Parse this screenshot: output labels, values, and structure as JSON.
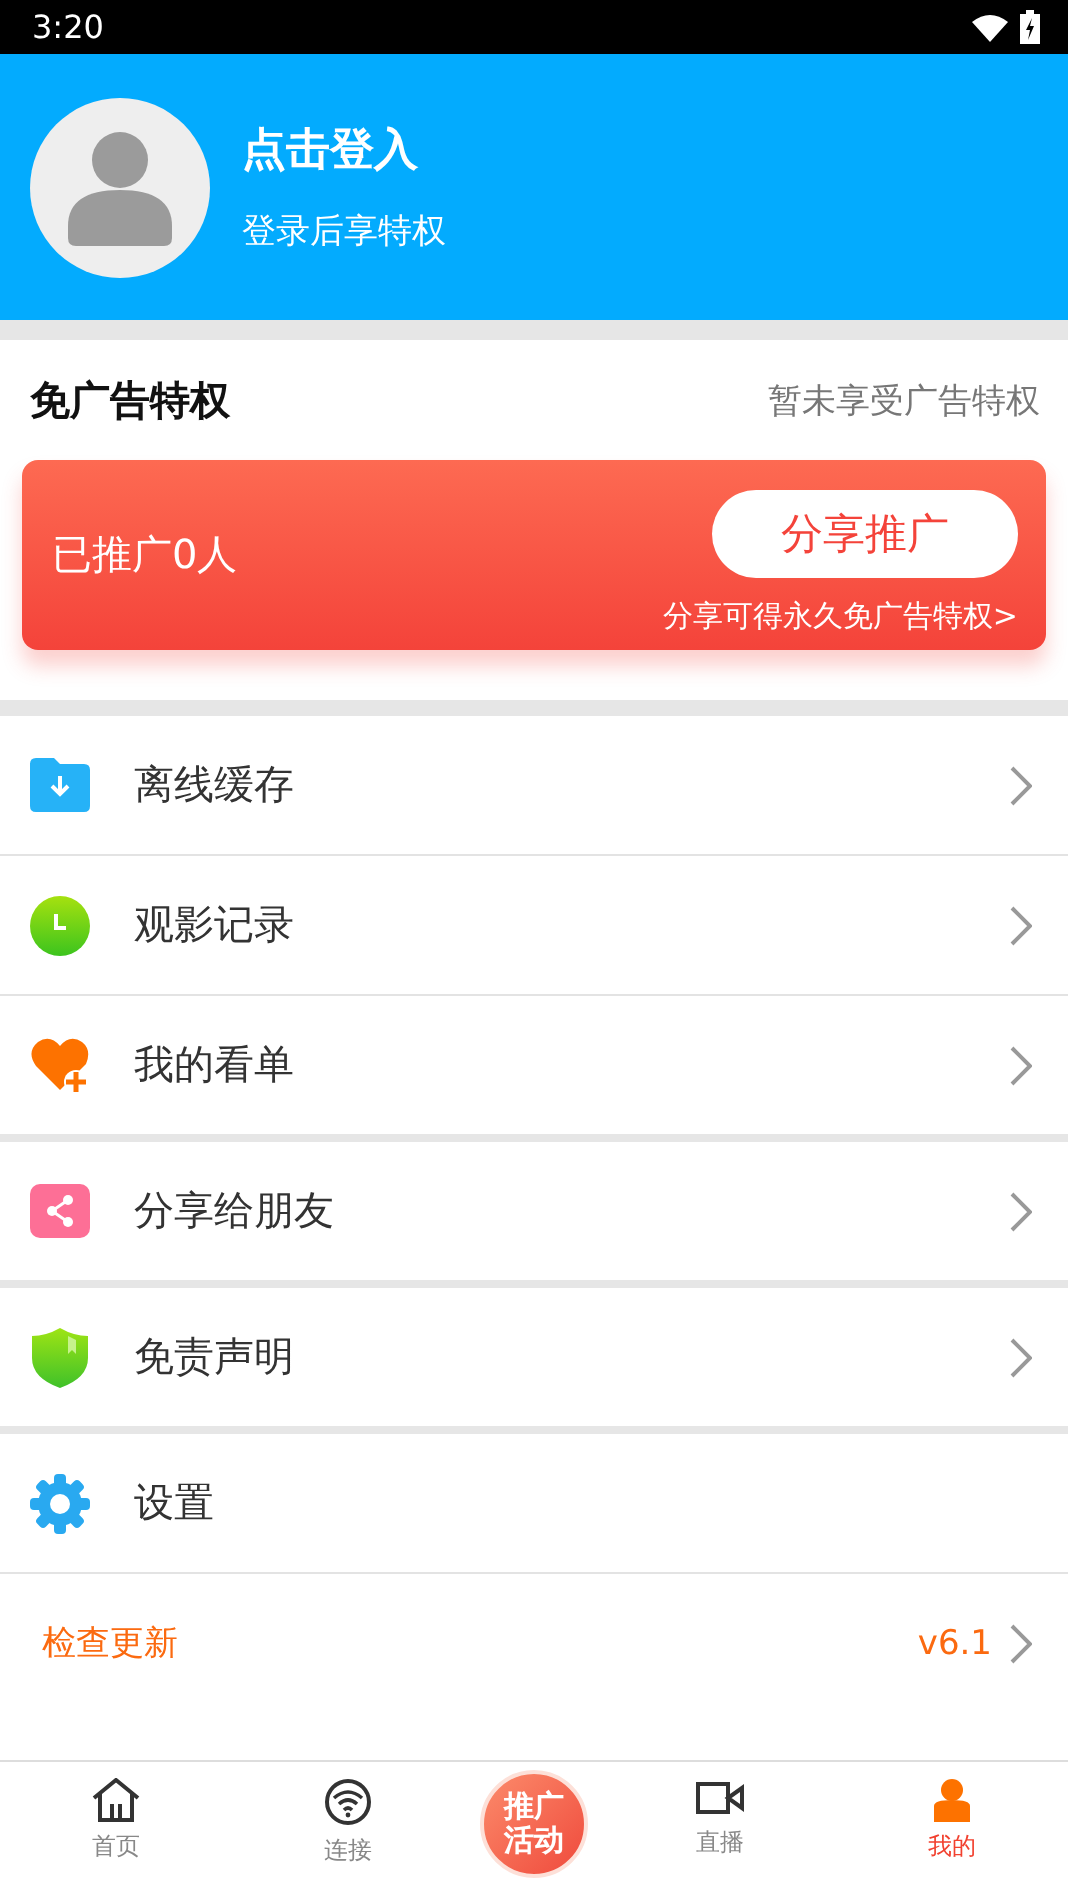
{
  "status_bar": {
    "time": "3:20"
  },
  "profile": {
    "title": "点击登入",
    "subtitle": "登录后享特权"
  },
  "ad_free": {
    "title": "免广告特权",
    "status": "暂未享受广告特权",
    "promoted": "已推广0人",
    "button": "分享推广",
    "hint": "分享可得永久免广告特权>"
  },
  "menu_groups": [
    [
      {
        "kind": "download",
        "label": "离线缓存"
      },
      {
        "kind": "history",
        "label": "观影记录"
      },
      {
        "kind": "watchlist",
        "label": "我的看单"
      }
    ],
    [
      {
        "kind": "share",
        "label": "分享给朋友"
      }
    ],
    [
      {
        "kind": "disclaimer",
        "label": "免责声明"
      }
    ],
    [
      {
        "kind": "settings",
        "label": "设置"
      },
      {
        "kind": "update",
        "label": "检查更新",
        "version": "v6.1"
      }
    ]
  ],
  "bottom_nav": [
    {
      "kind": "home",
      "label": "首页",
      "selected": false
    },
    {
      "kind": "connect",
      "label": "连接",
      "selected": false
    },
    {
      "kind": "promo",
      "label": "推广活动",
      "selected": false
    },
    {
      "kind": "live",
      "label": "直播",
      "selected": false
    },
    {
      "kind": "mine",
      "label": "我的",
      "selected": true
    }
  ]
}
